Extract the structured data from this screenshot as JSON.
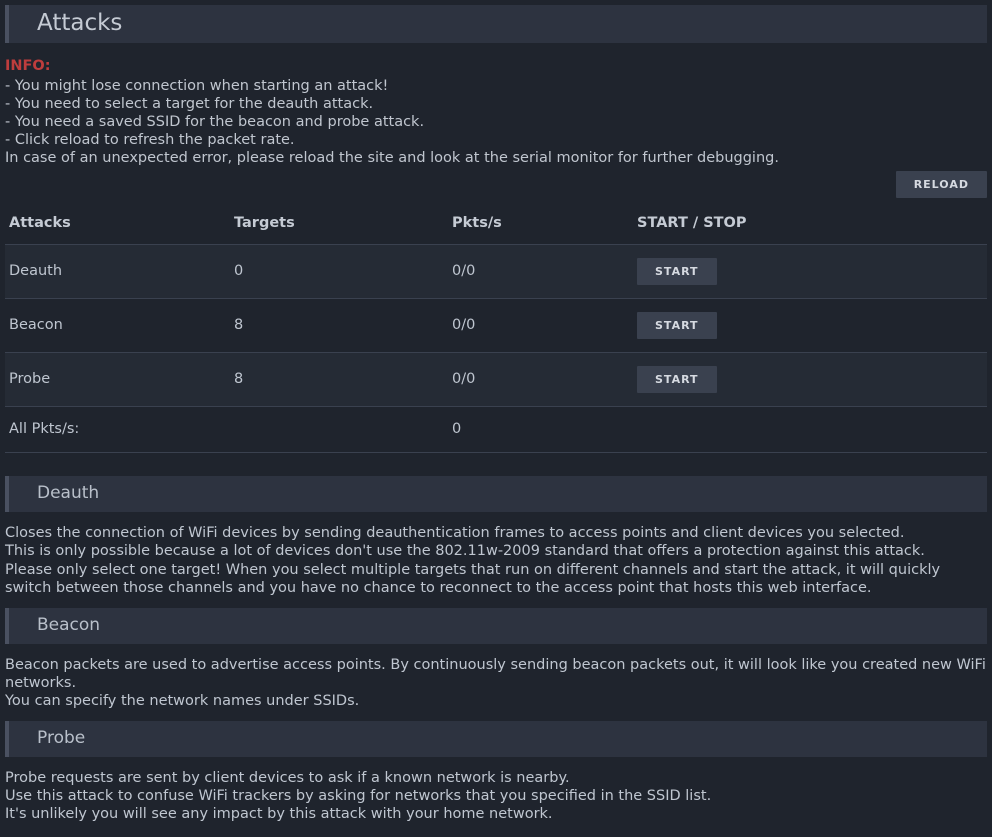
{
  "header": {
    "title": "Attacks"
  },
  "info": {
    "label": "INFO:",
    "lines": [
      "- You might lose connection when starting an attack!",
      "- You need to select a target for the deauth attack.",
      "- You need a saved SSID for the beacon and probe attack.",
      "- Click reload to refresh the packet rate.",
      "In case of an unexpected error, please reload the site and look at the serial monitor for further debugging."
    ]
  },
  "buttons": {
    "reload": "RELOAD",
    "start": "START"
  },
  "table": {
    "headers": {
      "attacks": "Attacks",
      "targets": "Targets",
      "pkts": "Pkts/s",
      "action": "START / STOP"
    },
    "rows": [
      {
        "name": "Deauth",
        "targets": "0",
        "pkts": "0/0"
      },
      {
        "name": "Beacon",
        "targets": "8",
        "pkts": "0/0"
      },
      {
        "name": "Probe",
        "targets": "8",
        "pkts": "0/0"
      }
    ],
    "footer": {
      "label": "All Pkts/s:",
      "value": "0"
    }
  },
  "sections": {
    "deauth": {
      "title": "Deauth",
      "body": "Closes the connection of WiFi devices by sending deauthentication frames to access points and client devices you selected.\nThis is only possible because a lot of devices don't use the 802.11w-2009 standard that offers a protection against this attack.\nPlease only select one target! When you select multiple targets that run on different channels and start the attack, it will quickly switch between those channels and you have no chance to reconnect to the access point that hosts this web interface."
    },
    "beacon": {
      "title": "Beacon",
      "body": "Beacon packets are used to advertise access points. By continuously sending beacon packets out, it will look like you created new WiFi networks.\nYou can specify the network names under SSIDs."
    },
    "probe": {
      "title": "Probe",
      "body": "Probe requests are sent by client devices to ask if a known network is nearby.\nUse this attack to confuse WiFi trackers by asking for networks that you specified in the SSID list.\nIt's unlikely you will see any impact by this attack with your home network."
    }
  }
}
